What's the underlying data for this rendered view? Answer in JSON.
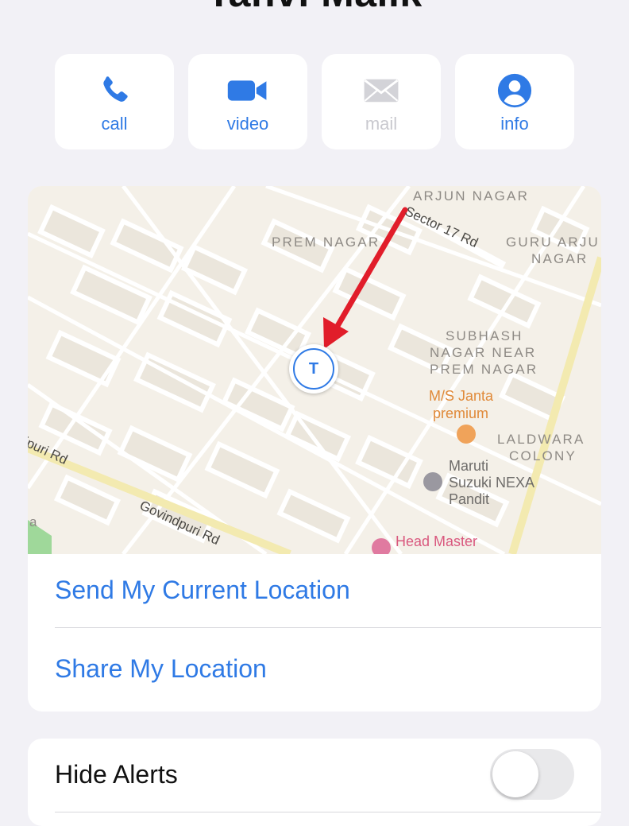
{
  "contact": {
    "name": "Tanvi Malik"
  },
  "actions": [
    {
      "label": "call",
      "enabled": true
    },
    {
      "label": "video",
      "enabled": true
    },
    {
      "label": "mail",
      "enabled": false
    },
    {
      "label": "info",
      "enabled": true
    }
  ],
  "map": {
    "labels": {
      "arjun_nagar": "ARJUN NAGAR",
      "prem_nagar": "PREM NAGAR",
      "guru_arju_1": "GURU ARJU",
      "guru_arju_2": "NAGAR",
      "subhash_1": "SUBHASH",
      "subhash_2": "NAGAR NEAR",
      "subhash_3": "PREM NAGAR",
      "laldwara_1": "LALDWARA",
      "laldwara_2": "COLONY",
      "a_label": "a"
    },
    "roads": {
      "sector17": "Sector 17 Rd",
      "govindpuri1": "Govindpuri Rd",
      "govindpuri2": "ipuri Rd"
    },
    "pois": {
      "janta_1": "M/S Janta",
      "janta_2": "premium",
      "maruti_1": "Maruti",
      "maruti_2": "Suzuki NEXA",
      "maruti_3": "Pandit",
      "head_master": "Head Master"
    },
    "marker_initial": "T",
    "colors": {
      "marker": "#2f7ae5",
      "arrow": "#e11d2a",
      "road_major": "#f3eab0"
    }
  },
  "location": {
    "send": "Send My Current Location",
    "share": "Share My Location"
  },
  "settings": {
    "hide_alerts": "Hide Alerts",
    "hide_alerts_on": false
  },
  "theme": {
    "accent": "#2f7ae5",
    "background": "#f2f1f6"
  }
}
